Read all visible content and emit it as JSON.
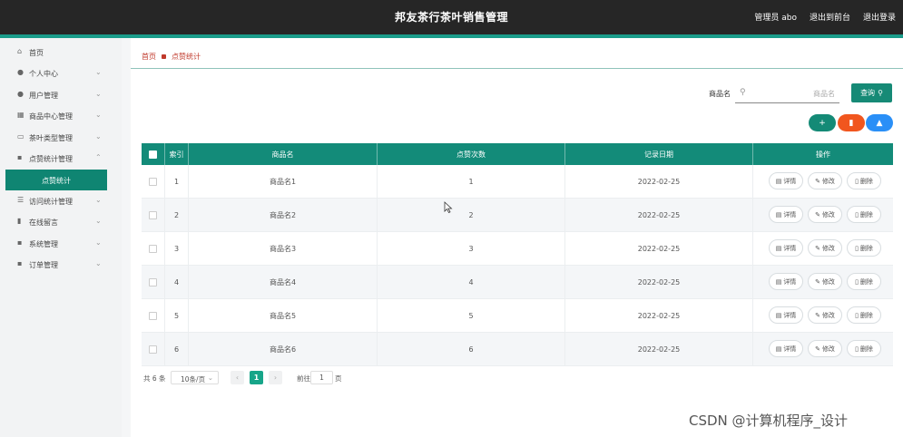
{
  "header": {
    "title": "邦友茶行茶叶销售管理",
    "user": "管理员 abo",
    "exit_to_front": "退出到前台",
    "logout": "退出登录"
  },
  "sidebar": {
    "items": [
      {
        "label": "首页",
        "icon": "home-icon"
      },
      {
        "label": "个人中心",
        "icon": "user-icon",
        "chevron": true
      },
      {
        "label": "用户管理",
        "icon": "users-icon",
        "chevron": true
      },
      {
        "label": "商品中心管理",
        "icon": "shop-icon",
        "chevron": true
      },
      {
        "label": "茶叶类型管理",
        "icon": "monitor-icon",
        "chevron": true
      },
      {
        "label": "点赞统计管理",
        "icon": "grid-icon",
        "chevron": true,
        "active_sub": "点赞统计"
      },
      {
        "label": "访问统计管理",
        "icon": "list-icon",
        "chevron": true
      },
      {
        "label": "在线留言",
        "icon": "chart-icon",
        "chevron": true
      },
      {
        "label": "系统管理",
        "icon": "grid-icon",
        "chevron": true
      },
      {
        "label": "订单管理",
        "icon": "grid-icon",
        "chevron": true
      }
    ]
  },
  "breadcrumb": {
    "home": "首页",
    "current": "点赞统计"
  },
  "search": {
    "label": "商品名",
    "placeholder": "商品名",
    "button": "查询"
  },
  "colors": {
    "primary": "#138b79",
    "add": "#148a76",
    "delete": "#f1561e",
    "export": "#2a8ff7"
  },
  "table": {
    "headers": {
      "index": "索引",
      "name": "商品名",
      "likes": "点赞次数",
      "date": "记录日期",
      "ops": "操作"
    },
    "actions": {
      "detail": "详情",
      "edit": "修改",
      "delete": "删除"
    },
    "rows": [
      {
        "index": "1",
        "name": "商品名1",
        "likes": "1",
        "date": "2022-02-25"
      },
      {
        "index": "2",
        "name": "商品名2",
        "likes": "2",
        "date": "2022-02-25"
      },
      {
        "index": "3",
        "name": "商品名3",
        "likes": "3",
        "date": "2022-02-25"
      },
      {
        "index": "4",
        "name": "商品名4",
        "likes": "4",
        "date": "2022-02-25"
      },
      {
        "index": "5",
        "name": "商品名5",
        "likes": "5",
        "date": "2022-02-25"
      },
      {
        "index": "6",
        "name": "商品名6",
        "likes": "6",
        "date": "2022-02-25"
      }
    ]
  },
  "pagination": {
    "total": "共 6 条",
    "page_size": "10条/页",
    "current_page": "1",
    "goto_label": "前往",
    "goto_value": "1",
    "page_word": "页"
  },
  "watermark": "CSDN @计算机程序_设计"
}
